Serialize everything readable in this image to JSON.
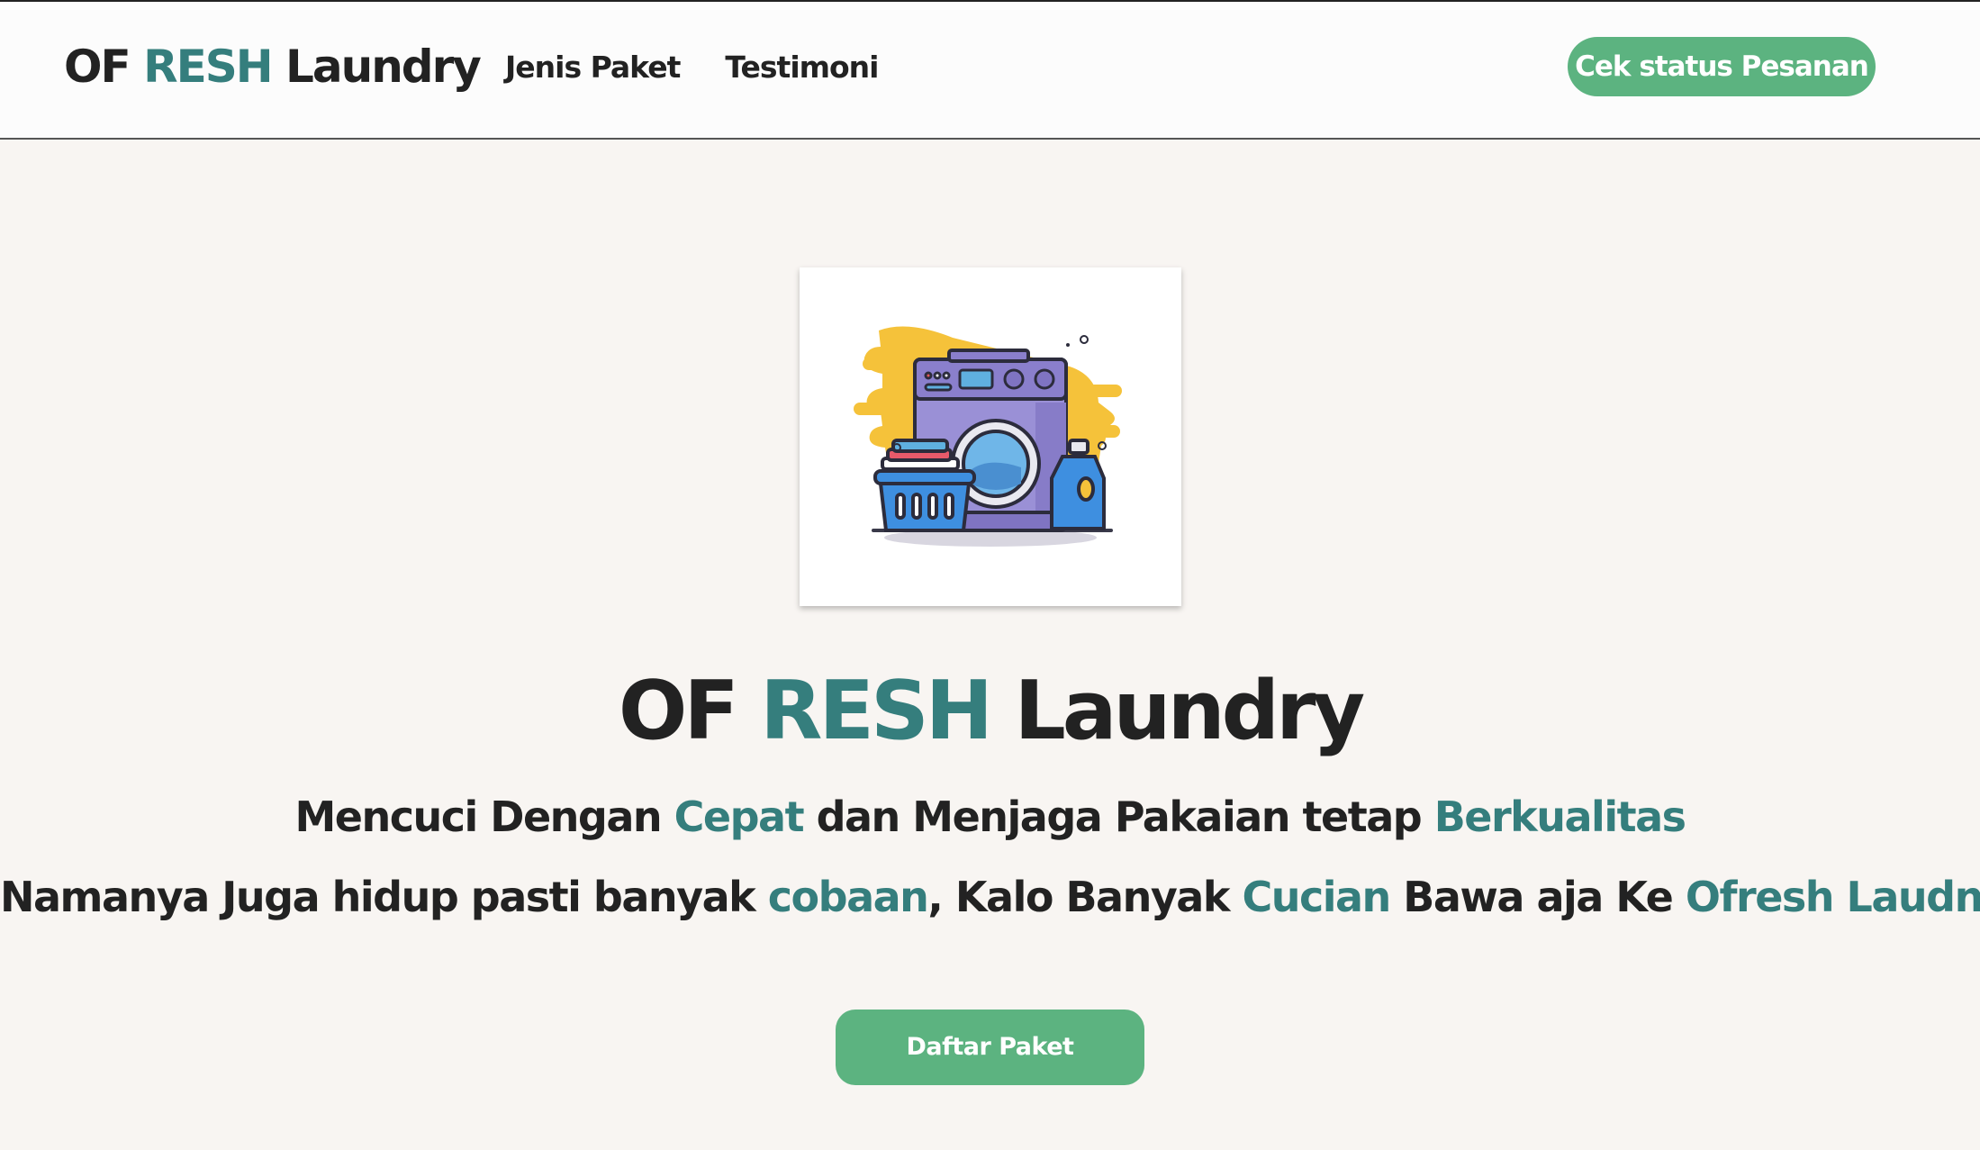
{
  "header": {
    "brand": {
      "part1": "OF ",
      "part2": "RESH",
      "part3": " Laundry"
    },
    "nav": [
      {
        "label": "Jenis Paket"
      },
      {
        "label": "Testimoni"
      }
    ],
    "status_button": "Cek status Pesanan"
  },
  "hero": {
    "image_icon": "washing-machine-illustration",
    "title": {
      "part1": "OF ",
      "part2": "RESH",
      "part3": " Laundry"
    },
    "tagline1": {
      "t1": "Mencuci Dengan ",
      "a1": "Cepat",
      "t2": " dan Menjaga Pakaian tetap ",
      "a2": "Berkualitas"
    },
    "tagline2": {
      "t1": "Namanya Juga hidup pasti banyak ",
      "a1": "cobaan",
      "t2": ", Kalo Banyak ",
      "a2": "Cucian",
      "t3": " Bawa aja Ke ",
      "a3": "Ofresh Laudnry"
    },
    "cta": "Daftar Paket"
  },
  "colors": {
    "accent": "#357e7d",
    "button": "#5cb380",
    "text": "#222222",
    "background": "#f8f5f2"
  }
}
